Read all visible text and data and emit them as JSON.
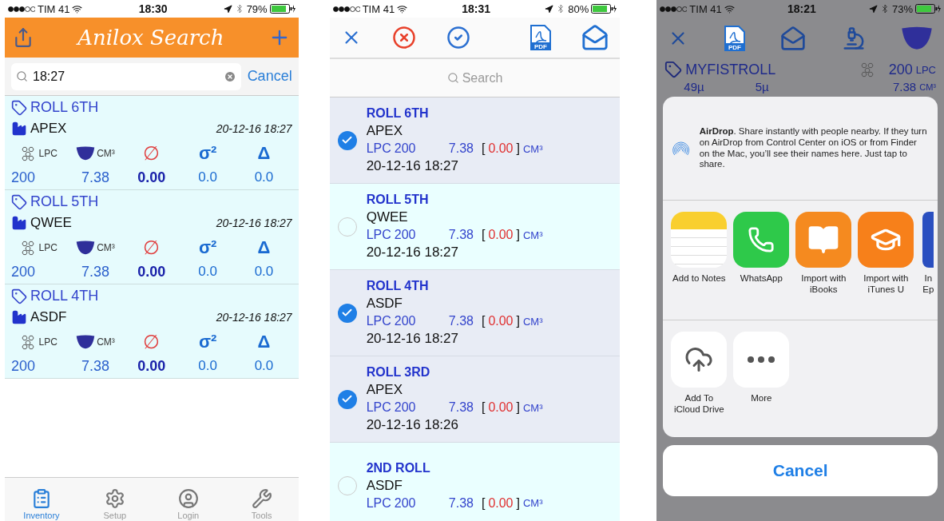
{
  "inventory_screen": {
    "status_bar": {
      "carrier": "TIM 41",
      "time": "18:30",
      "battery": "79%"
    },
    "header": {
      "title": "Anilox Search"
    },
    "search": {
      "value": "18:27",
      "cancel": "Cancel"
    },
    "rolls": [
      {
        "name": "ROLL 6TH",
        "company": "APEX",
        "date": "20-12-16 18:27",
        "lpc_label": "LPC",
        "volume_label": "CM³",
        "diameter_symbol": "∅",
        "variance_symbol": "σ²",
        "delta_symbol": "Δ",
        "lpc": "200",
        "volume": "7.38",
        "diameter": "0.00",
        "variance": "0.0",
        "delta": "0.0"
      },
      {
        "name": "ROLL 5TH",
        "company": "QWEE",
        "date": "20-12-16 18:27",
        "lpc_label": "LPC",
        "volume_label": "CM³",
        "diameter_symbol": "∅",
        "variance_symbol": "σ²",
        "delta_symbol": "Δ",
        "lpc": "200",
        "volume": "7.38",
        "diameter": "0.00",
        "variance": "0.0",
        "delta": "0.0"
      },
      {
        "name": "ROLL 4TH",
        "company": "ASDF",
        "date": "20-12-16 18:27",
        "lpc_label": "LPC",
        "volume_label": "CM³",
        "diameter_symbol": "∅",
        "variance_symbol": "σ²",
        "delta_symbol": "Δ",
        "lpc": "200",
        "volume": "7.38",
        "diameter": "0.00",
        "variance": "0.0",
        "delta": "0.0"
      }
    ],
    "tabs": [
      {
        "label": "Inventory",
        "kind": "clipboard",
        "selected": true
      },
      {
        "label": "Setup",
        "kind": "gear",
        "selected": false
      },
      {
        "label": "Login",
        "kind": "user",
        "selected": false
      },
      {
        "label": "Tools",
        "kind": "tools",
        "selected": false
      }
    ]
  },
  "selection_screen": {
    "status_bar": {
      "carrier": "TIM 41",
      "time": "18:31",
      "battery": "80%"
    },
    "toolbar": {
      "pdf_label": "PDF"
    },
    "search": {
      "placeholder": "Search"
    },
    "rolls": [
      {
        "name": "ROLL 6TH",
        "company": "APEX",
        "lpc_label": "LPC",
        "lpc": "200",
        "volume": "7.38",
        "open": "[",
        "deviation": "0.00",
        "close": "]",
        "unit": "CM³",
        "date": "20-12-16 18:27",
        "selected": true
      },
      {
        "name": "ROLL 5TH",
        "company": "QWEE",
        "lpc_label": "LPC",
        "lpc": "200",
        "volume": "7.38",
        "open": "[",
        "deviation": "0.00",
        "close": "]",
        "unit": "CM³",
        "date": "20-12-16 18:27",
        "selected": false
      },
      {
        "name": "ROLL 4TH",
        "company": "ASDF",
        "lpc_label": "LPC",
        "lpc": "200",
        "volume": "7.38",
        "open": "[",
        "deviation": "0.00",
        "close": "]",
        "unit": "CM³",
        "date": "20-12-16 18:27",
        "selected": true
      },
      {
        "name": "ROLL 3RD",
        "company": "APEX",
        "lpc_label": "LPC",
        "lpc": "200",
        "volume": "7.38",
        "open": "[",
        "deviation": "0.00",
        "close": "]",
        "unit": "CM³",
        "date": "20-12-16 18:26",
        "selected": true
      },
      {
        "name": "2ND ROLL",
        "company": "ASDF",
        "lpc_label": "LPC",
        "lpc": "200",
        "volume": "7.38",
        "open": "[",
        "deviation": "0.00",
        "close": "]",
        "unit": "CM³",
        "selected": false
      }
    ]
  },
  "share_screen": {
    "status_bar": {
      "carrier": "TIM 41",
      "time": "18:21",
      "battery": "73%"
    },
    "toolbar": {
      "pdf_label": "PDF"
    },
    "roll": {
      "name": "MYFISTROLL",
      "lpc": "200",
      "lpc_label": "LPC",
      "depth": "49µ",
      "wall": "5µ",
      "volume": "7.38",
      "volume_label": "CM³"
    },
    "airdrop": {
      "text": "**AirDrop**. Share instantly with people nearby. If they turn on AirDrop from Control Center on iOS or from Finder on the Mac, you’ll see their names here. Just tap to share."
    },
    "apps": [
      {
        "label": "Add to Notes",
        "kind": "notes"
      },
      {
        "label": "WhatsApp",
        "kind": "whatsapp"
      },
      {
        "label": "Import with iBooks",
        "kind": "ibooks"
      },
      {
        "label": "Import with iTunes U",
        "kind": "itunesu"
      },
      {
        "label": "In Ep",
        "kind": "partial"
      }
    ],
    "actions": [
      {
        "label": "Add To iCloud Drive",
        "kind": "icloud"
      },
      {
        "label": "More",
        "kind": "more"
      }
    ],
    "cancel": "Cancel"
  }
}
